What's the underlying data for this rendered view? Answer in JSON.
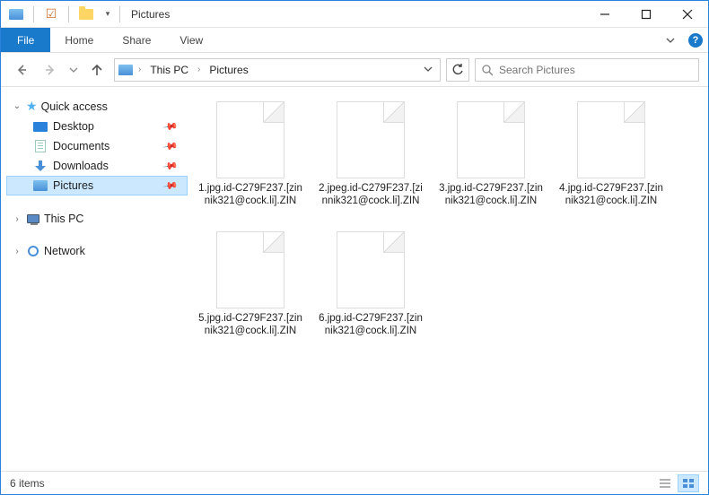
{
  "titlebar": {
    "title": "Pictures"
  },
  "ribbon": {
    "file": "File",
    "tabs": [
      "Home",
      "Share",
      "View"
    ]
  },
  "nav": {
    "breadcrumbs": [
      "This PC",
      "Pictures"
    ],
    "search_placeholder": "Search Pictures"
  },
  "sidebar": {
    "quick_access": {
      "label": "Quick access",
      "items": [
        {
          "label": "Desktop",
          "icon": "desktop",
          "pinned": true
        },
        {
          "label": "Documents",
          "icon": "doc",
          "pinned": true
        },
        {
          "label": "Downloads",
          "icon": "down",
          "pinned": true
        },
        {
          "label": "Pictures",
          "icon": "pic",
          "pinned": true,
          "selected": true
        }
      ]
    },
    "this_pc": {
      "label": "This PC"
    },
    "network": {
      "label": "Network"
    }
  },
  "files": [
    {
      "name": "1.jpg.id-C279F237.[zinnik321@cock.li].ZIN"
    },
    {
      "name": "2.jpeg.id-C279F237.[zinnik321@cock.li].ZIN"
    },
    {
      "name": "3.jpg.id-C279F237.[zinnik321@cock.li].ZIN"
    },
    {
      "name": "4.jpg.id-C279F237.[zinnik321@cock.li].ZIN"
    },
    {
      "name": "5.jpg.id-C279F237.[zinnik321@cock.li].ZIN"
    },
    {
      "name": "6.jpg.id-C279F237.[zinnik321@cock.li].ZIN"
    }
  ],
  "statusbar": {
    "count_text": "6 items"
  }
}
